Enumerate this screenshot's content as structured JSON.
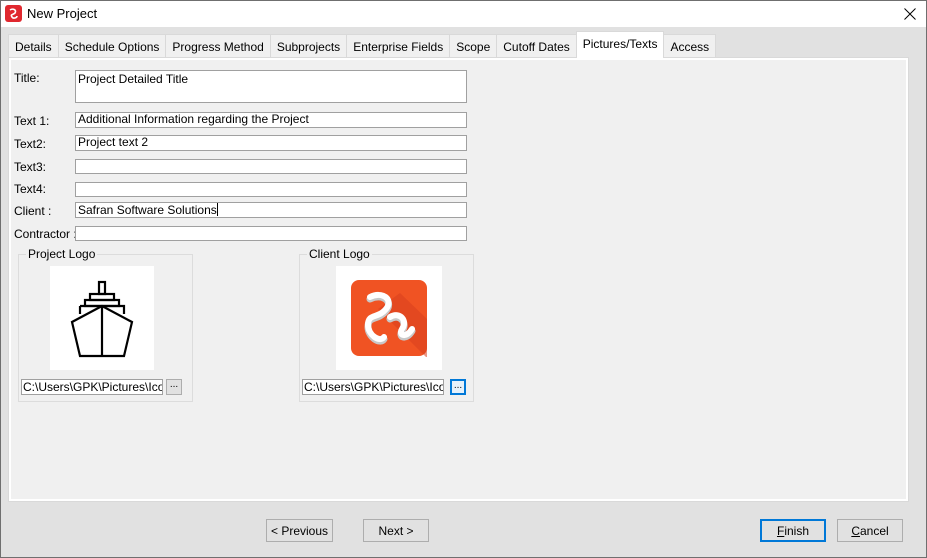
{
  "window": {
    "title": "New Project",
    "close_label": "Close"
  },
  "tabs": [
    {
      "label": "Details",
      "active": false
    },
    {
      "label": "Schedule Options",
      "active": false
    },
    {
      "label": "Progress Method",
      "active": false
    },
    {
      "label": "Subprojects",
      "active": false
    },
    {
      "label": "Enterprise Fields",
      "active": false
    },
    {
      "label": "Scope",
      "active": false
    },
    {
      "label": "Cutoff Dates",
      "active": false
    },
    {
      "label": "Pictures/Texts",
      "active": true
    },
    {
      "label": "Access",
      "active": false
    }
  ],
  "form": {
    "title": {
      "label": "Title:",
      "value": "Project Detailed Title"
    },
    "text1": {
      "label": "Text 1:",
      "value": "Additional Information regarding the Project"
    },
    "text2": {
      "label": "Text2:",
      "value": "Project text 2"
    },
    "text3": {
      "label": "Text3:",
      "value": ""
    },
    "text4": {
      "label": "Text4:",
      "value": ""
    },
    "client": {
      "label": "Client :",
      "value": "Safran Software Solutions"
    },
    "contractor": {
      "label": "Contractor :",
      "value": ""
    }
  },
  "project_logo": {
    "group_label": "Project Logo",
    "image": "ship-icon",
    "path": "C:\\Users\\GPK\\Pictures\\Icons\\",
    "browse_label": "..."
  },
  "client_logo": {
    "group_label": "Client Logo",
    "image": "safran-logo",
    "brand_color": "#f05323",
    "path": "C:\\Users\\GPK\\Pictures\\Icons\\",
    "browse_label": "..."
  },
  "buttons": {
    "previous": "< Previous",
    "next": "Next >",
    "finish_mnemonic": "F",
    "finish_rest": "inish",
    "cancel_mnemonic": "C",
    "cancel_rest": "ancel"
  },
  "colors": {
    "accent": "#0078d7",
    "app_icon": "#e0282f"
  }
}
